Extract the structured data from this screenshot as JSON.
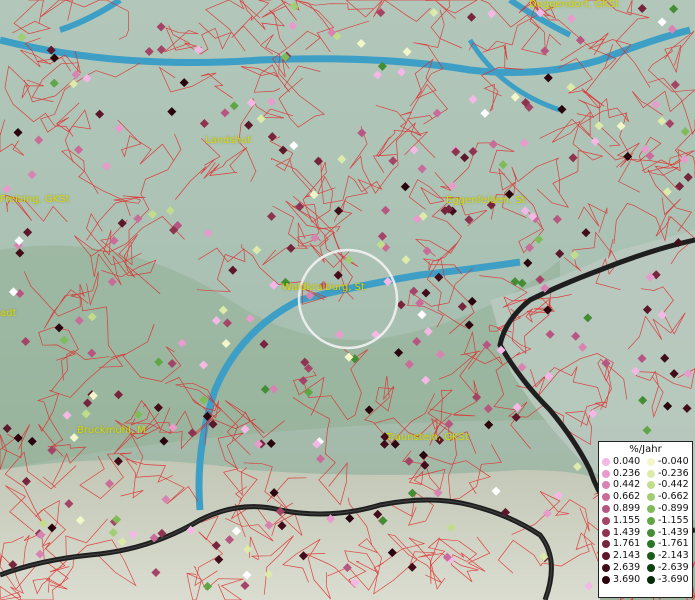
{
  "map": {
    "cities": [
      {
        "name": "Deggendorf, GKSt"
      },
      {
        "name": "Landshut"
      },
      {
        "name": "Freising, GKSt"
      },
      {
        "name": "Eggenfelden, St"
      },
      {
        "name": "Waldkraiburg, St"
      },
      {
        "name": "adt"
      },
      {
        "name": "Bruckmühl, M"
      },
      {
        "name": "Traunstein, GKSt"
      }
    ],
    "legend": {
      "title": "%/Jahr",
      "positive": [
        {
          "label": "0.040",
          "color": "#f4b8e6"
        },
        {
          "label": "0.236",
          "color": "#e79ccc"
        },
        {
          "label": "0.442",
          "color": "#d884b2"
        },
        {
          "label": "0.662",
          "color": "#c96c9a"
        },
        {
          "label": "0.899",
          "color": "#b75680"
        },
        {
          "label": "1.155",
          "color": "#a44466"
        },
        {
          "label": "1.439",
          "color": "#8e3450"
        },
        {
          "label": "1.761",
          "color": "#76253c"
        },
        {
          "label": "2.143",
          "color": "#5c182a"
        },
        {
          "label": "2.639",
          "color": "#420d1a"
        },
        {
          "label": "3.690",
          "color": "#2a050d"
        }
      ],
      "negative": [
        {
          "label": "-0.040",
          "color": "#f2f6c8"
        },
        {
          "label": "-0.236",
          "color": "#dcebaa"
        },
        {
          "label": "-0.442",
          "color": "#c1dd8c"
        },
        {
          "label": "-0.662",
          "color": "#a2cd72"
        },
        {
          "label": "-0.899",
          "color": "#80bb5a"
        },
        {
          "label": "-1.155",
          "color": "#60a646"
        },
        {
          "label": "-1.439",
          "color": "#438e34"
        },
        {
          "label": "-1.761",
          "color": "#2c7626"
        },
        {
          "label": "-2.143",
          "color": "#1a5c1a"
        },
        {
          "label": "-2.639",
          "color": "#0c4010"
        },
        {
          "label": "-3.690",
          "color": "#042a08"
        }
      ]
    }
  }
}
